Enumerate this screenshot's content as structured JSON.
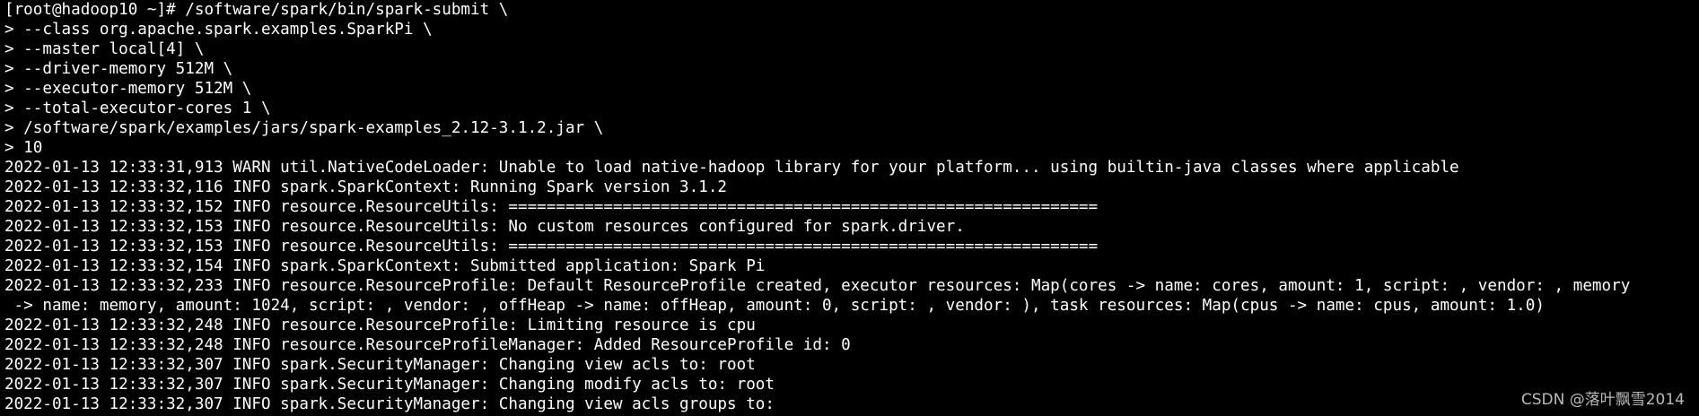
{
  "colors": {
    "background": "#000000",
    "text": "#ffffff",
    "watermark": "#b9b9b9"
  },
  "terminal": {
    "lines": [
      "[root@hadoop10 ~]# /software/spark/bin/spark-submit \\",
      "> --class org.apache.spark.examples.SparkPi \\",
      "> --master local[4] \\",
      "> --driver-memory 512M \\",
      "> --executor-memory 512M \\",
      "> --total-executor-cores 1 \\",
      "> /software/spark/examples/jars/spark-examples_2.12-3.1.2.jar \\",
      "> 10",
      "2022-01-13 12:33:31,913 WARN util.NativeCodeLoader: Unable to load native-hadoop library for your platform... using builtin-java classes where applicable",
      "2022-01-13 12:33:32,116 INFO spark.SparkContext: Running Spark version 3.1.2",
      "2022-01-13 12:33:32,152 INFO resource.ResourceUtils: ==============================================================",
      "2022-01-13 12:33:32,153 INFO resource.ResourceUtils: No custom resources configured for spark.driver.",
      "2022-01-13 12:33:32,153 INFO resource.ResourceUtils: ==============================================================",
      "2022-01-13 12:33:32,154 INFO spark.SparkContext: Submitted application: Spark Pi",
      "2022-01-13 12:33:32,233 INFO resource.ResourceProfile: Default ResourceProfile created, executor resources: Map(cores -> name: cores, amount: 1, script: , vendor: , memory",
      " -> name: memory, amount: 1024, script: , vendor: , offHeap -> name: offHeap, amount: 0, script: , vendor: ), task resources: Map(cpus -> name: cpus, amount: 1.0)",
      "2022-01-13 12:33:32,248 INFO resource.ResourceProfile: Limiting resource is cpu",
      "2022-01-13 12:33:32,248 INFO resource.ResourceProfileManager: Added ResourceProfile id: 0",
      "2022-01-13 12:33:32,307 INFO spark.SecurityManager: Changing view acls to: root",
      "2022-01-13 12:33:32,307 INFO spark.SecurityManager: Changing modify acls to: root",
      "2022-01-13 12:33:32,307 INFO spark.SecurityManager: Changing view acls groups to:"
    ]
  },
  "watermark": {
    "text": "CSDN @落叶飘雪2014"
  }
}
